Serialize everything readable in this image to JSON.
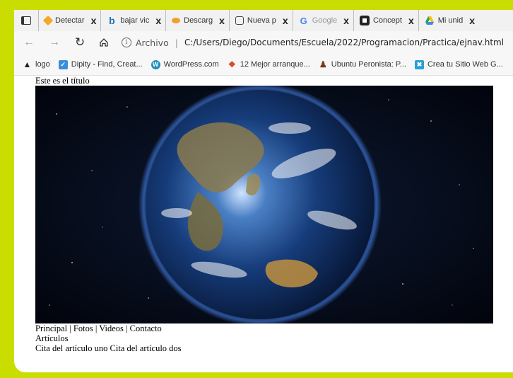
{
  "tabs": [
    {
      "title": "Detectar",
      "icon": "diamond-icon",
      "color": "#f5a623"
    },
    {
      "title": "bajar vic",
      "icon": "bing-icon",
      "color": "#1e73be"
    },
    {
      "title": "Descarg",
      "icon": "download-icon",
      "color": "#f0a030"
    },
    {
      "title": "Nueva p",
      "icon": "new-page-icon",
      "color": "#444444"
    },
    {
      "title": "Google",
      "icon": "google-icon",
      "color": "#4285f4"
    },
    {
      "title": "Concept",
      "icon": "concept-icon",
      "color": "#222222"
    },
    {
      "title": "Mi unid",
      "icon": "drive-icon",
      "color": "#1fa463"
    }
  ],
  "tab_close_glyph": "x",
  "address": {
    "security_label": "Archivo",
    "separator": "|",
    "url": "C:/Users/Diego/Documents/Escuela/2022/Programacion/Practica/ejnav.html"
  },
  "bookmarks": [
    {
      "label": "logo",
      "icon": "logo-icon",
      "color": "#222222"
    },
    {
      "label": "Dipity - Find, Creat...",
      "icon": "dipity-icon",
      "color": "#3b8ed8"
    },
    {
      "label": "WordPress.com",
      "icon": "wordpress-icon",
      "color": "#1e8cbe"
    },
    {
      "label": "12 Mejor arranque...",
      "icon": "bookmark-red-icon",
      "color": "#d94a2b"
    },
    {
      "label": "Ubuntu Peronista: P...",
      "icon": "ubuntu-icon",
      "color": "#7a3b12"
    },
    {
      "label": "Crea tu Sitio Web G...",
      "icon": "sitebuilder-icon",
      "color": "#2a9fd6"
    }
  ],
  "page": {
    "title": "Este es el título",
    "nav_principal": "Principal",
    "nav_fotos": "Fotos",
    "nav_videos": "Videos",
    "nav_contacto": "Contacto",
    "nav_sep": " | ",
    "section": "Artículos",
    "quote_one": "Cita del artículo uno",
    "quote_two": "Cita del artículo dos"
  },
  "colors": {
    "border_accent": "#c9dd00"
  }
}
